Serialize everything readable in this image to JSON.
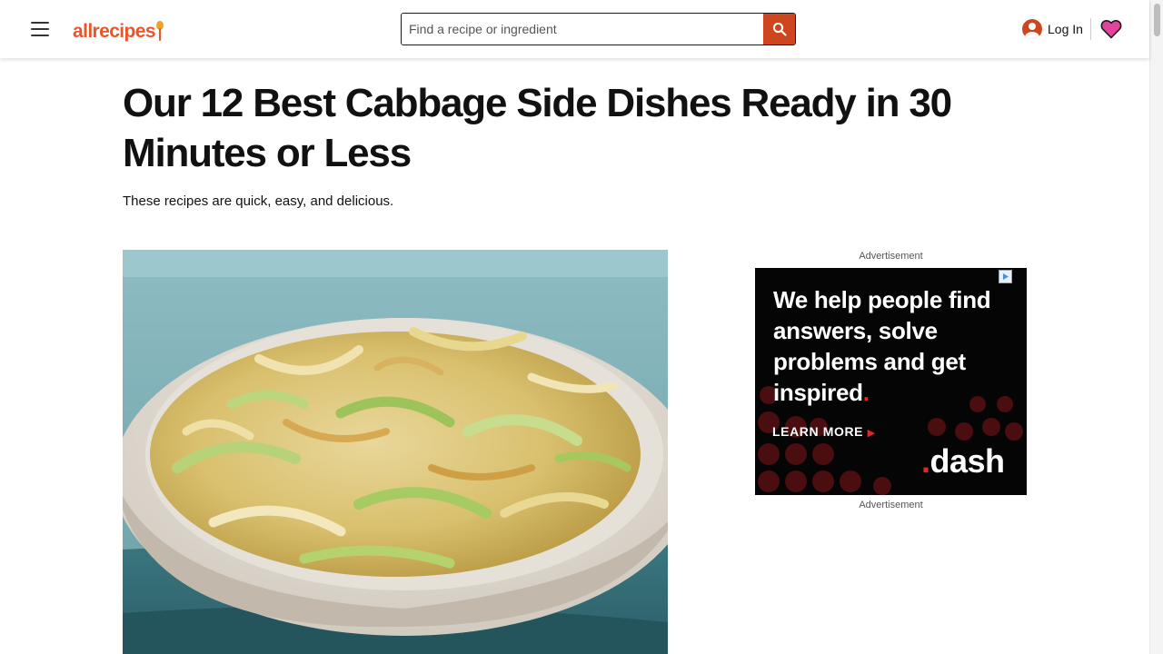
{
  "header": {
    "logo_text": "allrecipes",
    "search_placeholder": "Find a recipe or ingredient",
    "login_label": "Log In"
  },
  "article": {
    "title": "Our 12 Best Cabbage Side Dishes Ready in 30 Minutes or Less",
    "subtitle": "These recipes are quick, easy, and delicious."
  },
  "ad": {
    "label_top": "Advertisement",
    "label_bottom": "Advertisement",
    "headline_main": "We help people find answers, solve problems and get inspired",
    "headline_dot": ".",
    "cta": "LEARN MORE",
    "brand_dot": ".",
    "brand_name": "dash"
  },
  "colors": {
    "brand_orange": "#ce4620",
    "logo_orange": "#e8562a",
    "ad_background": "#050505",
    "ad_accent_red": "#e8232a",
    "heart_pink": "#e0459b"
  },
  "icons": {
    "menu": "hamburger-menu-icon",
    "search": "search-icon",
    "user": "user-account-icon",
    "favorites": "heart-icon",
    "adchoices": "adchoices-icon"
  }
}
